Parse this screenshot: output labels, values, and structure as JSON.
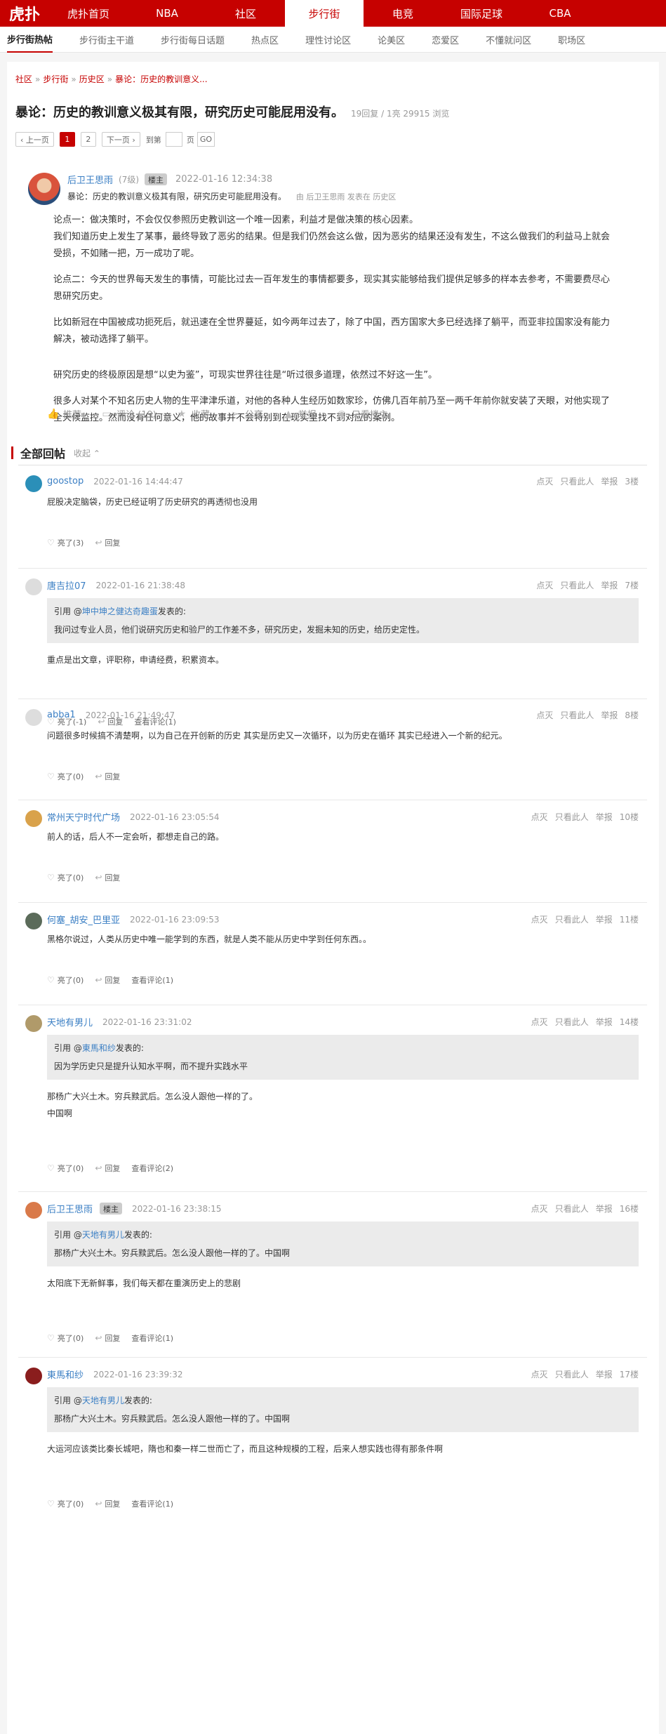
{
  "topnav": {
    "logo": "虎扑",
    "items": [
      "虎扑首页",
      "NBA",
      "社区",
      "步行街",
      "电竞",
      "国际足球",
      "CBA"
    ]
  },
  "subnav": {
    "items": [
      "步行街热帖",
      "步行街主干道",
      "步行街每日话题",
      "热点区",
      "理性讨论区",
      "论美区",
      "恋爱区",
      "不懂就问区",
      "职场区"
    ]
  },
  "breadcrumb": [
    "社区",
    "步行街",
    "历史区",
    "暴论：历史的教训意义..."
  ],
  "post": {
    "title": "暴论：历史的教训意义极其有限，研究历史可能屁用没有。",
    "stats": "19回复 / 1亮 29915 浏览",
    "pager": {
      "prev": "‹ 上一页",
      "pages": [
        "1",
        "2"
      ],
      "next": "下一页 ›",
      "goto_prefix": "到第",
      "goto_suffix": "页",
      "go": "GO"
    },
    "author": "后卫王思雨",
    "level": "(7级)",
    "badge": "楼主",
    "time": "2022-01-16 12:34:38",
    "subtitle": "暴论：历史的教训意义极其有限，研究历史可能屁用没有。",
    "by_line": "由 后卫王思雨 发表在 历史区",
    "body": [
      "论点一：做决策时，不会仅仅参照历史教训这一个唯一因素，利益才是做决策的核心因素。",
      "我们知道历史上发生了某事，最终导致了恶劣的结果。但是我们仍然会这么做，因为恶劣的结果还没有发生，不这么做我们的利益马上就会受损，不如赌一把，万一成功了呢。",
      "论点二：今天的世界每天发生的事情，可能比过去一百年发生的事情都要多，现实其实能够给我们提供足够多的样本去参考，不需要费尽心思研究历史。",
      "比如新冠在中国被成功扼死后，就迅速在全世界蔓延，如今两年过去了，除了中国，西方国家大多已经选择了躺平，而亚非拉国家没有能力解决，被动选择了躺平。",
      "研究历史的终极原因是想“以史为鉴”，可现实世界往往是“听过很多道理，依然过不好这一生”。",
      "很多人对某个不知名历史人物的生平津津乐道，对他的各种人生经历如数家珍，仿佛几百年前乃至一两千年前你就安装了天眼，对他实现了全天候监控。然而没有任何意义，他的故事并不会特别到在现实里找不到对应的案例。"
    ],
    "actions": {
      "recommend": "推荐",
      "comment": "评论 (19)",
      "collect": "收藏",
      "share": "分享",
      "report": "举报",
      "only_op": "只看楼主"
    }
  },
  "section": {
    "title": "全部回帖",
    "fold": "收起 ⌃"
  },
  "reply_tools": {
    "light": "点灭",
    "only": "只看此人",
    "report": "举报"
  },
  "replies": [
    {
      "user": "goostop",
      "time": "2022-01-16 14:44:47",
      "floor": "3楼",
      "quote_user": "",
      "quote_text": "",
      "text": [
        "屁股决定脑袋，历史已经证明了历史研究的再透彻也没用"
      ],
      "like": "亮了(3)",
      "reply": "回复",
      "view": "",
      "avatar": "#2b8fb8"
    },
    {
      "user": "唐吉拉07",
      "time": "2022-01-16 21:38:48",
      "floor": "7楼",
      "quote_user": "坤中坤之健达奇趣蛋",
      "quote_text": "我问过专业人员，他们说研究历史和验尸的工作差不多，研究历史，发掘未知的历史，给历史定性。",
      "text": [
        "重点是出文章，评职称，申请经费，积累资本。"
      ],
      "like": "亮了(-1)",
      "reply": "回复",
      "view": "查看评论(1)",
      "avatar": "#dddddd"
    },
    {
      "user": "abba1",
      "time": "2022-01-16 21:49:47",
      "floor": "8楼",
      "quote_user": "",
      "quote_text": "",
      "text": [
        "问题很多时候搞不清楚啊，以为自己在开创新的历史 其实是历史又一次循环，以为历史在循环 其实已经进入一个新的纪元。"
      ],
      "like": "亮了(0)",
      "reply": "回复",
      "view": "",
      "avatar": "#dddddd"
    },
    {
      "user": "常州天宁时代广场",
      "time": "2022-01-16 23:05:54",
      "floor": "10楼",
      "quote_user": "",
      "quote_text": "",
      "text": [
        "前人的话，后人不一定会听，都想走自己的路。"
      ],
      "like": "亮了(0)",
      "reply": "回复",
      "view": "",
      "avatar": "#d9a24b"
    },
    {
      "user": "何塞_胡安_巴里亚",
      "time": "2022-01-16 23:09:53",
      "floor": "11楼",
      "quote_user": "",
      "quote_text": "",
      "text": [
        "黑格尔说过，人类从历史中唯一能学到的东西，就是人类不能从历史中学到任何东西。。"
      ],
      "like": "亮了(0)",
      "reply": "回复",
      "view": "查看评论(1)",
      "avatar": "#5b6b5a"
    },
    {
      "user": "天地有男儿",
      "time": "2022-01-16 23:31:02",
      "floor": "14楼",
      "quote_user": "東馬和纱",
      "quote_text": "因为学历史只是提升认知水平啊，而不提升实践水平",
      "text": [
        "那杨广大兴土木。穷兵黩武后。怎么没人跟他一样的了。",
        "中国啊"
      ],
      "like": "亮了(0)",
      "reply": "回复",
      "view": "查看评论(2)",
      "avatar": "#b09a6a"
    },
    {
      "user": "后卫王思雨",
      "badge": "楼主",
      "time": "2022-01-16 23:38:15",
      "floor": "16楼",
      "quote_user": "天地有男儿",
      "quote_text": "那杨广大兴土木。穷兵黩武后。怎么没人跟他一样的了。中国啊",
      "text": [
        "太阳底下无新鲜事，我们每天都在重演历史上的悲剧"
      ],
      "like": "亮了(0)",
      "reply": "回复",
      "view": "查看评论(1)",
      "avatar": "#d97a4a"
    },
    {
      "user": "東馬和纱",
      "time": "2022-01-16 23:39:32",
      "floor": "17楼",
      "quote_user": "天地有男儿",
      "quote_text": "那杨广大兴土木。穷兵黩武后。怎么没人跟他一样的了。中国啊",
      "text": [
        "大运河应该类比秦长城吧，隋也和秦一样二世而亡了，而且这种规模的工程，后来人想实践也得有那条件啊"
      ],
      "like": "亮了(0)",
      "reply": "回复",
      "view": "查看评论(1)",
      "avatar": "#8a1d1d"
    }
  ],
  "quote_prefix": "引用 @",
  "quote_suffix": "发表的:"
}
